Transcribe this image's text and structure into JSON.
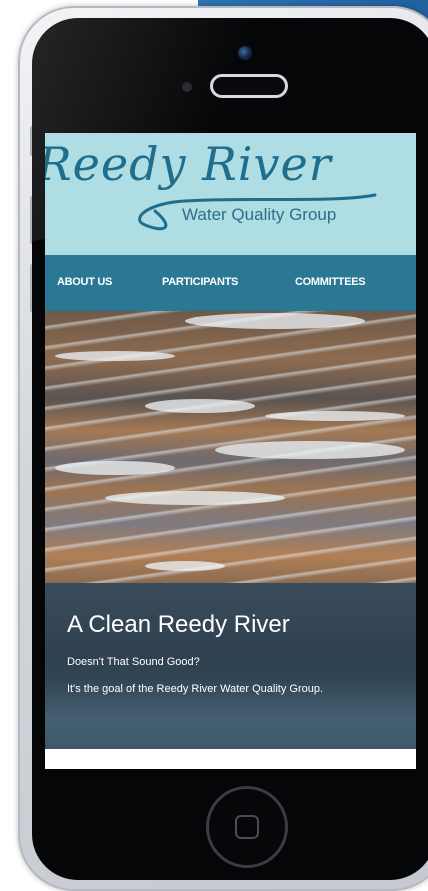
{
  "site": {
    "logo_script": "Reedy River",
    "logo_subtitle": "Water Quality Group"
  },
  "nav": {
    "items": [
      {
        "label": "ABOUT US"
      },
      {
        "label": "PARTICIPANTS"
      },
      {
        "label": "COMMITTEES"
      }
    ]
  },
  "hero": {
    "image": "river-rapids-photo",
    "title": "A Clean Reedy River",
    "line1": "Doesn't That Sound Good?",
    "line2": "It's the goal of the Reedy River Water Quality Group."
  },
  "device": {
    "type": "smartphone",
    "colors": {
      "frame": "#d3d6db",
      "bezel": "#050608",
      "header_bg": "#aedde3",
      "nav_bg": "#2a7894",
      "logo_text": "#1f6e8d"
    }
  }
}
